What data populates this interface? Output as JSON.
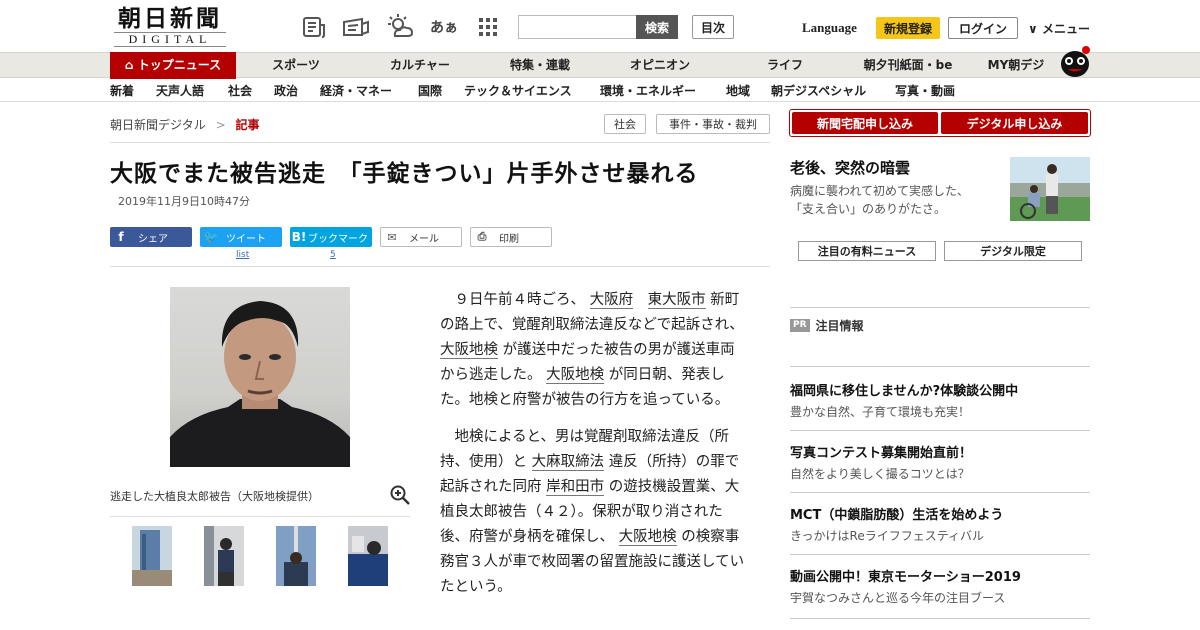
{
  "header": {
    "logo_kanji": "朝日新聞",
    "logo_sub": "DIGITAL",
    "icons": [
      "news-icon",
      "edition-icon",
      "weather-icon",
      "font-size-icon",
      "apps-icon"
    ],
    "font_size_glyph": "あぁ",
    "search_placeholder": "",
    "search_button": "検索",
    "mokuji": "目次",
    "language": "Language",
    "register": "新規登録",
    "login": "ログイン",
    "menu": "メニュー"
  },
  "gnav": [
    "トップニュース",
    "スポーツ",
    "カルチャー",
    "特集・連載",
    "オピニオン",
    "ライフ",
    "朝夕刊紙面・be",
    "MY朝デジ"
  ],
  "snav": [
    "新着",
    "天声人語",
    "社会",
    "政治",
    "経済・マネー",
    "国際",
    "テック＆サイエンス",
    "環境・エネルギー",
    "地域",
    "朝デジスペシャル",
    "写真・動画"
  ],
  "breadcrumb": {
    "home": "朝日新聞デジタル",
    "sep": ">",
    "current": "記事"
  },
  "tags": [
    "社会",
    "事件・事故・裁判"
  ],
  "article": {
    "title": "大阪でまた被告逃走　「手錠きつい」片手外させ暴れる",
    "date": "2019年11月9日10時47分",
    "share": {
      "facebook": "シェア",
      "twitter": "ツイート",
      "hatena": "ブックマーク",
      "mail": "メール",
      "print": "印刷",
      "twitter_count": "list",
      "hatena_count": "5"
    },
    "photo_caption": "逃走した大植良太郎被告（大阪地検提供）",
    "p1": {
      "a": "９日午前４時ごろ、",
      "l1": "大阪府",
      "l2": "東大阪市",
      "b": "新町の路上で、覚醒剤取締法違反などで起訴され、",
      "l3": "大阪地検",
      "c": "が護送中だった被告の男が護送車両から逃走した。",
      "l4": "大阪地検",
      "d": "が同日朝、発表した。地検と府警が被告の行方を追っている。"
    },
    "p2": {
      "a": "地検によると、男は覚醒剤取締法違反（所持、使用）と",
      "l1": "大麻取締法",
      "b": "違反（所持）の罪で起訴された同府",
      "l2": "岸和田市",
      "c": "の遊技機設置業、大植良太郎被告（４２）。保釈が取り消された後、府警が身柄を確保し、",
      "l3": "大阪地検",
      "d": "の検察事務官３人が車で枚岡署の留置施設に護送していたという。"
    }
  },
  "sidebar": {
    "subscribe_paper": "新聞宅配申し込み",
    "subscribe_digital": "デジタル申し込み",
    "feature_title": "老後、突然の暗雲",
    "feature_sub1": "病魔に襲われて初めて実感した、",
    "feature_sub2": "「支え合い」のありがたさ。",
    "btn_paid": "注目の有料ニュース",
    "btn_digital": "デジタル限定",
    "pr_badge": "PR",
    "pr_label": "注目情報",
    "ads": [
      {
        "title": "福岡県に移住しませんか?体験談公開中",
        "sub": "豊かな自然、子育て環境も充実！"
      },
      {
        "title": "写真コンテスト募集開始直前！",
        "sub": "自然をより美しく撮るコツとは？"
      },
      {
        "title": "MCT（中鎖脂肪酸）生活を始めよう",
        "sub": "きっかけはReライフフェスティバル"
      },
      {
        "title": "動画公開中！東京モーターショー2019",
        "sub": "宇賀なつみさんと巡る今年の注目ブース"
      }
    ]
  },
  "colors": {
    "brand": "#b40000",
    "accent": "#f5c518",
    "facebook": "#3b5998",
    "twitter": "#1da1f2",
    "hatena": "#00a4de"
  }
}
